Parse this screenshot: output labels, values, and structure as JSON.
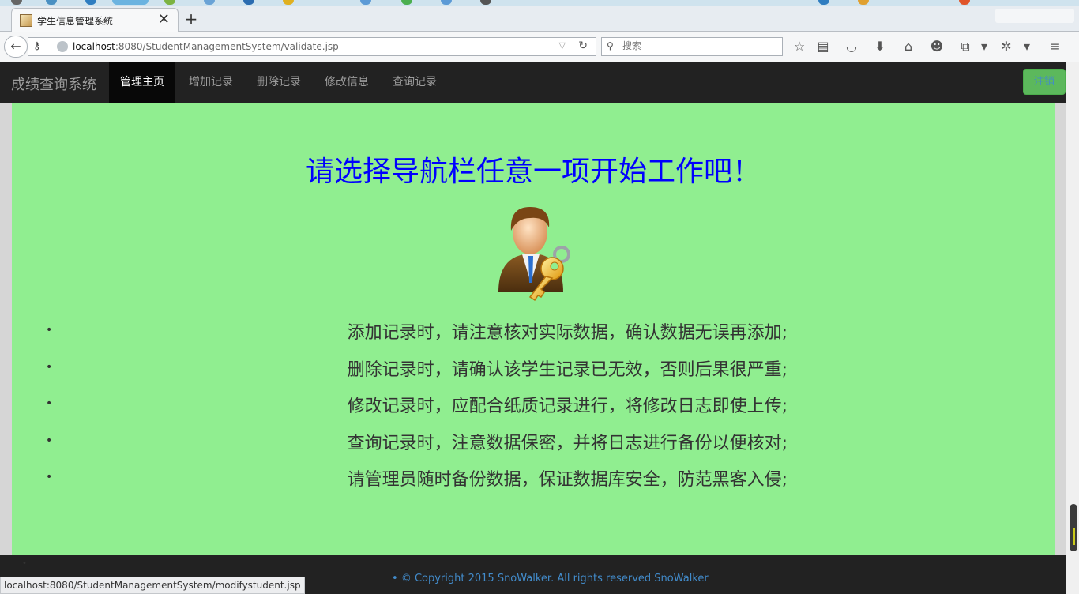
{
  "browser": {
    "tab_title": "学生信息管理系统",
    "url_host": "localhost",
    "url_rest": ":8080/StudentManagementSystem/validate.jsp",
    "search_placeholder": "搜索",
    "status_url": "localhost:8080/StudentManagementSystem/modifystudent.jsp"
  },
  "site": {
    "brand": "成绩查询系统",
    "nav": [
      {
        "label": "管理主页",
        "active": true
      },
      {
        "label": "增加记录",
        "active": false
      },
      {
        "label": "删除记录",
        "active": false
      },
      {
        "label": "修改信息",
        "active": false
      },
      {
        "label": "查询记录",
        "active": false
      }
    ],
    "logout_label": "注销"
  },
  "main": {
    "heading": "请选择导航栏任意一项开始工作吧！",
    "tips": [
      "添加记录时，请注意核对实际数据，确认数据无误再添加;",
      "删除记录时，请确认该学生记录已无效，否则后果很严重;",
      "修改记录时，应配合纸质记录进行，将修改日志即使上传;",
      "查询记录时，注意数据保密，并将日志进行备份以便核对;",
      "请管理员随时备份数据，保证数据库安全，防范黑客入侵;"
    ],
    "bullet": "•"
  },
  "footer": {
    "copyright": "© Copyright 2015 SnoWalker. All rights reserved ",
    "author_link": "SnoWalker"
  },
  "colors": {
    "content_bg": "#90ee90",
    "heading": "#0000ff",
    "navbar_bg": "#222222",
    "logout_bg": "#5cb85c",
    "link": "#428bca"
  }
}
